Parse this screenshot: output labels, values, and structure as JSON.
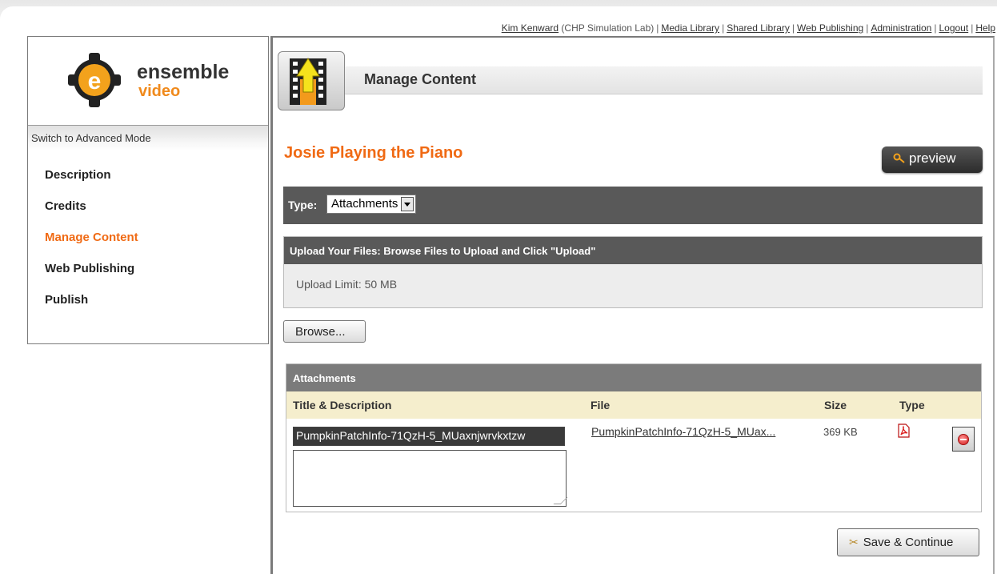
{
  "top_nav": {
    "user_name": "Kim Kenward",
    "org": "(CHP Simulation Lab)",
    "links": [
      "Media Library",
      "Shared Library",
      "Web Publishing",
      "Administration",
      "Logout",
      "Help"
    ]
  },
  "logo": {
    "name": "ensemble",
    "sub": "video"
  },
  "sidebar": {
    "mode_toggle": "Switch to Advanced Mode",
    "items": [
      {
        "label": "Description",
        "active": false
      },
      {
        "label": "Credits",
        "active": false
      },
      {
        "label": "Manage Content",
        "active": true
      },
      {
        "label": "Web Publishing",
        "active": false
      },
      {
        "label": "Publish",
        "active": false
      }
    ]
  },
  "header": {
    "title": "Manage Content"
  },
  "content": {
    "item_title": "Josie Playing the Piano",
    "preview_label": "preview",
    "type_label": "Type:",
    "type_value": "Attachments",
    "upload_heading": "Upload Your Files: Browse Files to Upload and Click \"Upload\"",
    "upload_limit": "Upload Limit: 50 MB",
    "browse_label": "Browse..."
  },
  "attachments": {
    "heading": "Attachments",
    "columns": [
      "Title & Description",
      "File",
      "Size",
      "Type"
    ],
    "rows": [
      {
        "title": "PumpkinPatchInfo-71QzH-5_MUaxnjwrvkxtzw",
        "description": "",
        "file": "PumpkinPatchInfo-71QzH-5_MUax...",
        "size": "369 KB",
        "type_icon": "pdf-icon"
      }
    ]
  },
  "footer": {
    "save_label": "Save & Continue"
  },
  "colors": {
    "accent": "#f06a14",
    "dark_bar": "#595959",
    "column_header": "#f5eecd"
  }
}
